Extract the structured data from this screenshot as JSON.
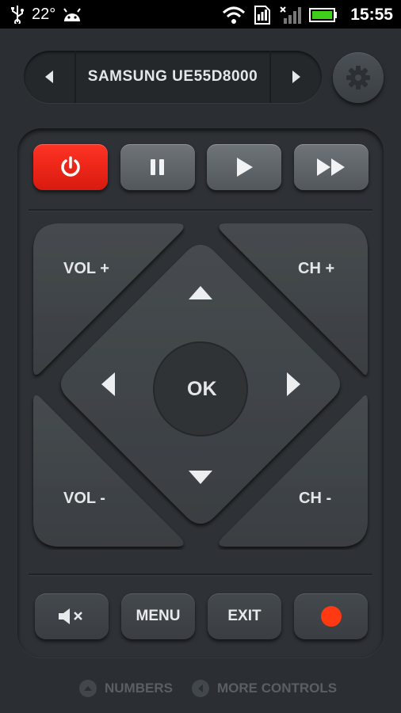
{
  "status": {
    "temperature": "22°",
    "time": "15:55"
  },
  "device": {
    "name": "SAMSUNG UE55D8000"
  },
  "remote": {
    "vol_up": "VOL +",
    "vol_down": "VOL -",
    "ch_up": "CH +",
    "ch_down": "CH -",
    "ok": "OK",
    "menu": "MENU",
    "exit": "EXIT"
  },
  "footer": {
    "numbers": "NUMBERS",
    "more_controls": "MORE CONTROLS"
  },
  "colors": {
    "power": "#e8221a",
    "record": "#ff3a12",
    "battery": "#3fcf1a"
  }
}
